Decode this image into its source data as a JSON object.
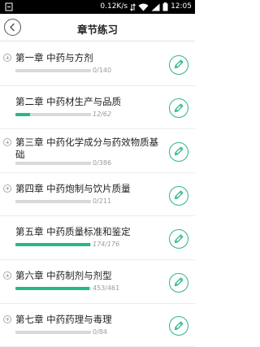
{
  "status": {
    "speed": "0.12K/s",
    "time": "12:05"
  },
  "header": {
    "title": "章节练习"
  },
  "colors": {
    "accent": "#26b888",
    "track": "#d9d9d9"
  },
  "chapters": [
    {
      "title": "第一章 中药与方剂",
      "progress": "0/140",
      "fraction": 0.0,
      "expand_icon": true,
      "italic": false
    },
    {
      "title": "第二章 中药材生产与品质",
      "progress": "12/62",
      "fraction": 0.194,
      "expand_icon": false,
      "italic": true
    },
    {
      "title": "第三章 中药化学成分与药效物质基础",
      "progress": "0/386",
      "fraction": 0.0,
      "expand_icon": true,
      "italic": false
    },
    {
      "title": "第四章 中药炮制与饮片质量",
      "progress": "0/211",
      "fraction": 0.0,
      "expand_icon": true,
      "italic": false
    },
    {
      "title": "第五章 中药质量标准和鉴定",
      "progress": "174/176",
      "fraction": 0.989,
      "expand_icon": false,
      "italic": true
    },
    {
      "title": "第六章 中药制剂与剂型",
      "progress": "453/461",
      "fraction": 0.983,
      "expand_icon": true,
      "italic": false
    },
    {
      "title": "第七章 中药药理与毒理",
      "progress": "0/84",
      "fraction": 0.0,
      "expand_icon": true,
      "italic": false
    }
  ]
}
